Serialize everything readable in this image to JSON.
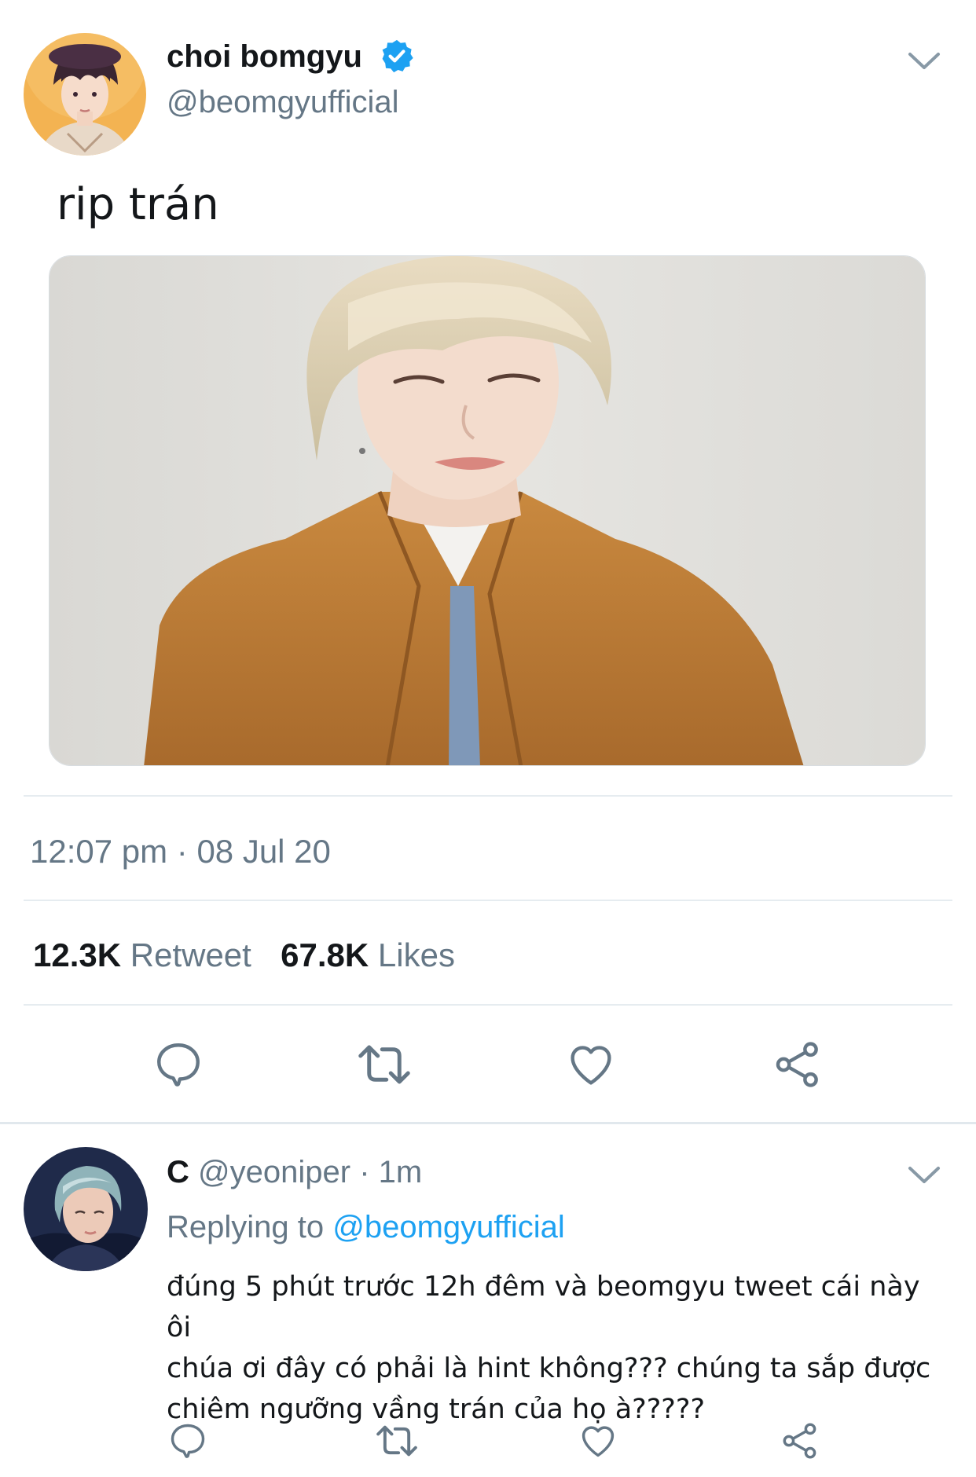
{
  "tweet": {
    "author": {
      "display_name": "choi bomgyu",
      "handle": "@beomgyufficial",
      "verified": true,
      "verified_color": "#1da1f2"
    },
    "text": "rip trán",
    "timestamp": "12:07 pm · 08 Jul 20",
    "stats": {
      "retweets_count": "12.3K",
      "retweets_label": "Retweet",
      "likes_count": "67.8K",
      "likes_label": "Likes"
    },
    "actions": [
      "reply-icon",
      "retweet-icon",
      "like-icon",
      "share-icon"
    ]
  },
  "reply": {
    "author": {
      "display_name": "C",
      "handle": "@yeoniper",
      "time": "· 1m"
    },
    "replying_to_label": "Replying to",
    "replying_to_handle": "@beomgyufficial",
    "lines": [
      "đúng 5 phút trước 12h đêm và beomgyu tweet cái này ôi",
      "chúa ơi đây có phải là hint không??? chúng ta sắp được",
      "chiêm ngưỡng vầng trán của họ à?????"
    ],
    "actions": [
      "reply-icon",
      "retweet-icon",
      "like-icon",
      "share-icon"
    ]
  },
  "colors": {
    "text_primary": "#14171a",
    "text_secondary": "#657786",
    "accent": "#1da1f2",
    "divider": "#e6ecf0"
  }
}
